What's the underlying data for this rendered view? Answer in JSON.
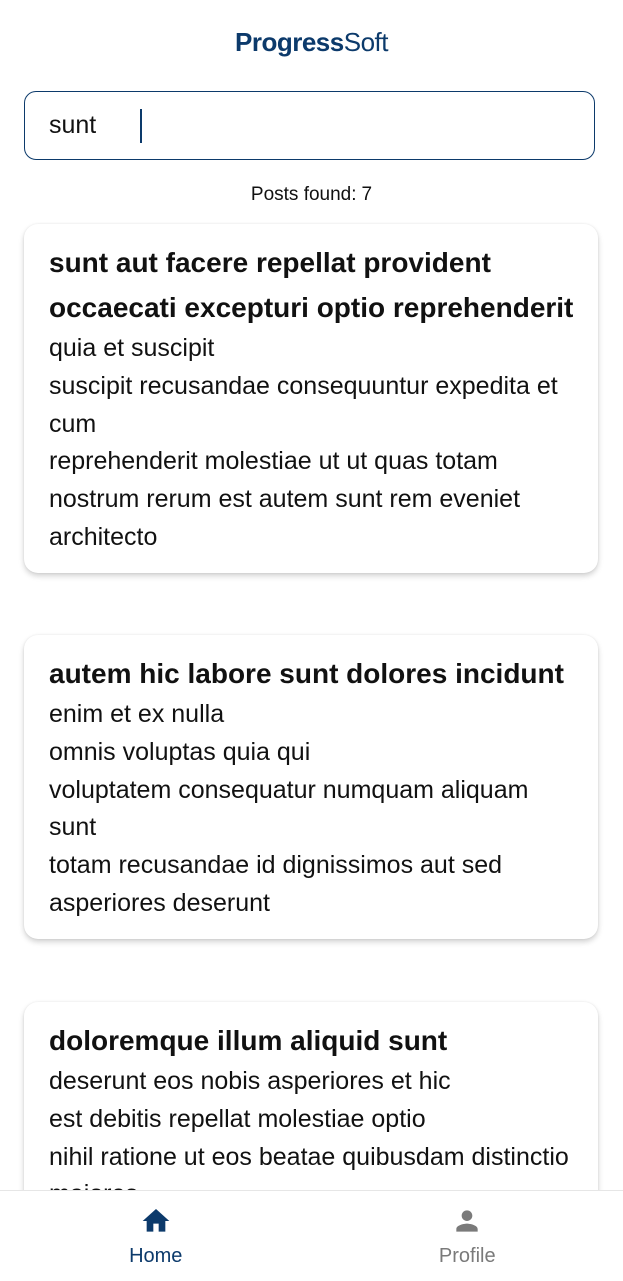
{
  "header": {
    "logo_bold": "Progress",
    "logo_light": "Soft"
  },
  "search": {
    "value": "sunt"
  },
  "results": {
    "label": "Posts found:",
    "count": "7"
  },
  "posts": [
    {
      "title": "sunt aut facere repellat provident occaecati excepturi optio reprehenderit",
      "body": "quia et suscipit\nsuscipit recusandae consequuntur expedita et cum\nreprehenderit molestiae ut ut quas totam\nnostrum rerum est autem sunt rem eveniet architecto"
    },
    {
      "title": "autem hic labore sunt dolores incidunt",
      "body": "enim et ex nulla\nomnis voluptas quia qui\nvoluptatem consequatur numquam aliquam sunt\ntotam recusandae id dignissimos aut sed asperiores deserunt"
    },
    {
      "title": "doloremque illum aliquid sunt",
      "body": "deserunt eos nobis asperiores et hic\nest debitis repellat molestiae optio\nnihil ratione ut eos beatae quibusdam distinctio maiores"
    }
  ],
  "nav": {
    "home": {
      "label": "Home",
      "icon": "home-icon"
    },
    "profile": {
      "label": "Profile",
      "icon": "person-icon"
    }
  },
  "colors": {
    "brand": "#0c3a6b",
    "inactive": "#7a7a7a"
  }
}
